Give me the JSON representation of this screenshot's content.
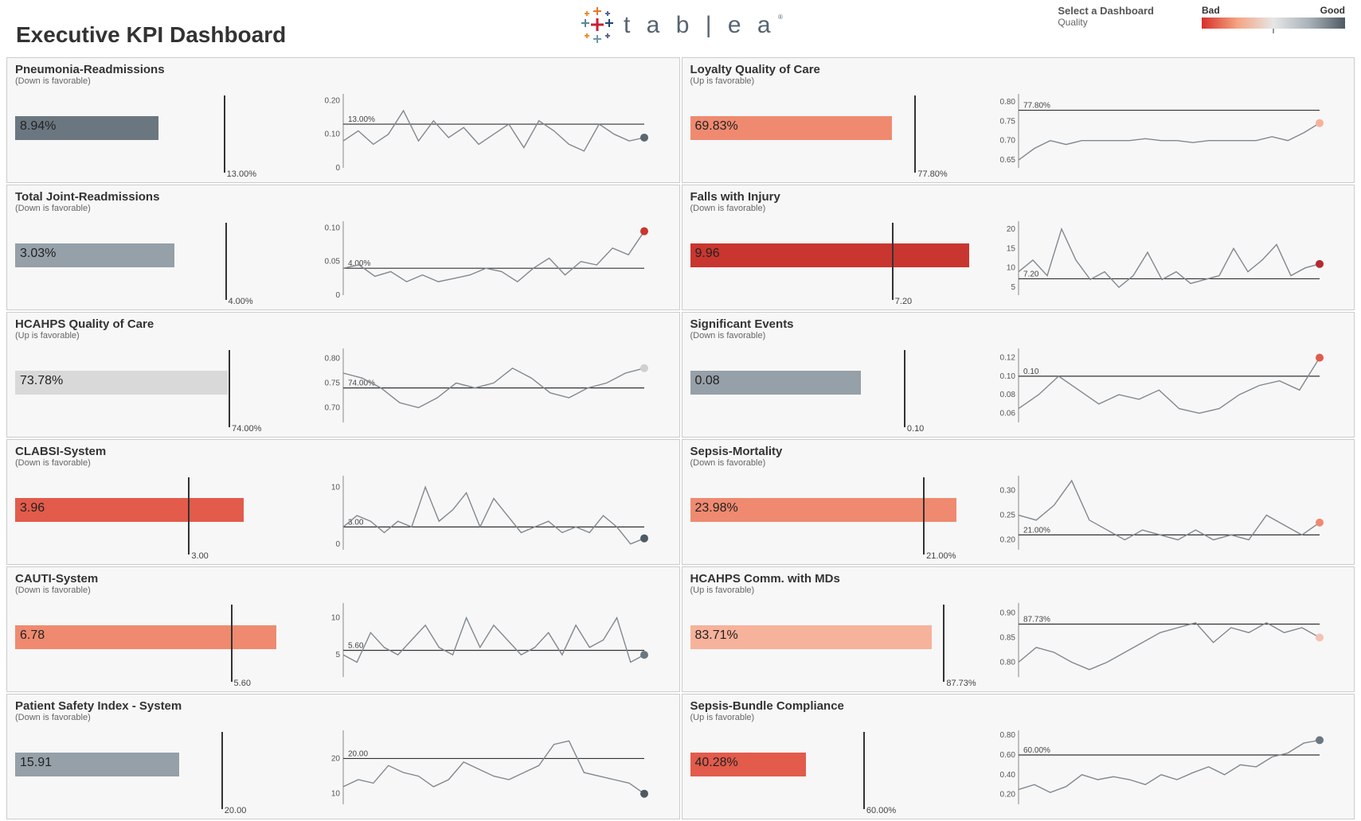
{
  "header": {
    "title": "Executive KPI Dashboard",
    "logo_text": "tableau",
    "selector_label": "Select a Dashboard",
    "selector_value": "Quality",
    "legend_bad": "Bad",
    "legend_good": "Good"
  },
  "colors": {
    "bad_deep": "#c8362f",
    "bad": "#e25b4b",
    "bad_light": "#ef8a70",
    "bad_pale": "#f7b29b",
    "neutral": "#d9d9d9",
    "good_light": "#95a0a8",
    "good": "#6b7780"
  },
  "chart_data": [
    {
      "id": "pneumonia",
      "title": "Pneumonia-Readmissions",
      "subtitle": "(Down is favorable)",
      "direction": "down",
      "value_display": "8.94%",
      "value": 8.94,
      "target": 13.0,
      "target_display": "13.00%",
      "bar_max": 18,
      "bar_color": "good",
      "spark": {
        "type": "line",
        "goal": 0.13,
        "goal_display": "13.00%",
        "ylim": [
          0.0,
          0.22
        ],
        "yticks": [
          0.0,
          0.1,
          0.2
        ],
        "values": [
          0.08,
          0.11,
          0.07,
          0.1,
          0.17,
          0.08,
          0.14,
          0.09,
          0.12,
          0.07,
          0.1,
          0.13,
          0.06,
          0.14,
          0.11,
          0.07,
          0.05,
          0.13,
          0.1,
          0.08,
          0.09
        ],
        "end_color": "#5b6770"
      }
    },
    {
      "id": "loyalty",
      "title": "Loyalty Quality of Care",
      "subtitle": "(Up is favorable)",
      "direction": "up",
      "value_display": "69.83%",
      "value": 69.83,
      "target": 77.8,
      "target_display": "77.80%",
      "bar_max": 100,
      "bar_color": "bad2",
      "spark": {
        "type": "line",
        "goal": 0.778,
        "goal_display": "77.80%",
        "ylim": [
          0.63,
          0.82
        ],
        "yticks": [
          0.65,
          0.7,
          0.75,
          0.8
        ],
        "values": [
          0.65,
          0.68,
          0.7,
          0.69,
          0.7,
          0.7,
          0.7,
          0.7,
          0.705,
          0.7,
          0.7,
          0.695,
          0.7,
          0.7,
          0.7,
          0.7,
          0.71,
          0.7,
          0.72,
          0.745
        ],
        "end_color": "#f7b29b"
      }
    },
    {
      "id": "joint",
      "title": "Total Joint-Readmissions",
      "subtitle": "(Down is favorable)",
      "direction": "down",
      "value_display": "3.03%",
      "value": 3.03,
      "target": 4.0,
      "target_display": "4.00%",
      "bar_max": 5.5,
      "bar_color": "good_light",
      "spark": {
        "type": "line",
        "goal": 0.04,
        "goal_display": "4.00%",
        "ylim": [
          0.0,
          0.11
        ],
        "yticks": [
          0.0,
          0.05,
          0.1
        ],
        "values": [
          0.04,
          0.045,
          0.028,
          0.035,
          0.02,
          0.03,
          0.02,
          0.025,
          0.03,
          0.04,
          0.035,
          0.02,
          0.04,
          0.055,
          0.03,
          0.05,
          0.045,
          0.07,
          0.06,
          0.095
        ],
        "end_color": "#c8362f"
      }
    },
    {
      "id": "falls",
      "title": "Falls with Injury",
      "subtitle": "(Down is favorable)",
      "direction": "down",
      "value_display": "9.96",
      "value": 9.96,
      "target": 7.2,
      "target_display": "7.20",
      "bar_max": 10.3,
      "bar_color": "bad4",
      "spark": {
        "type": "line",
        "goal": 7.2,
        "goal_display": "7.20",
        "ylim": [
          3,
          22
        ],
        "yticks": [
          5,
          10,
          15,
          20
        ],
        "values": [
          9,
          12,
          8,
          20,
          12,
          7,
          9,
          5,
          8,
          14,
          7,
          9,
          6,
          7,
          8,
          15,
          9,
          12,
          16,
          8,
          10,
          11
        ],
        "end_color": "#b42b2f"
      }
    },
    {
      "id": "hcahps_quality",
      "title": "HCAHPS Quality of Care",
      "subtitle": "(Up is favorable)",
      "direction": "up",
      "value_display": "73.78%",
      "value": 73.78,
      "target": 74.0,
      "target_display": "74.00%",
      "bar_max": 100,
      "bar_color": "neutral",
      "spark": {
        "type": "line",
        "goal": 0.74,
        "goal_display": "74.00%",
        "ylim": [
          0.67,
          0.82
        ],
        "yticks": [
          0.7,
          0.75,
          0.8
        ],
        "values": [
          0.77,
          0.76,
          0.74,
          0.71,
          0.7,
          0.72,
          0.75,
          0.74,
          0.75,
          0.78,
          0.76,
          0.73,
          0.72,
          0.74,
          0.75,
          0.77,
          0.78
        ],
        "end_color": "#d0d0d0"
      }
    },
    {
      "id": "sig_events",
      "title": "Significant Events",
      "subtitle": "(Down is favorable)",
      "direction": "down",
      "value_display": "0.08",
      "value": 0.08,
      "target": 0.1,
      "target_display": "0.10",
      "bar_max": 0.135,
      "bar_color": "good_light",
      "spark": {
        "type": "line",
        "goal": 0.1,
        "goal_display": "0.10",
        "ylim": [
          0.05,
          0.13
        ],
        "yticks": [
          0.06,
          0.08,
          0.1,
          0.12
        ],
        "values": [
          0.065,
          0.08,
          0.1,
          0.085,
          0.07,
          0.08,
          0.075,
          0.085,
          0.065,
          0.06,
          0.065,
          0.08,
          0.09,
          0.095,
          0.085,
          0.12
        ],
        "end_color": "#e25b4b"
      }
    },
    {
      "id": "clabsi",
      "title": "CLABSI-System",
      "subtitle": "(Down is favorable)",
      "direction": "down",
      "value_display": "3.96",
      "value": 3.96,
      "target": 3.0,
      "target_display": "3.00",
      "bar_max": 5.0,
      "bar_color": "bad3",
      "spark": {
        "type": "line",
        "goal": 3.0,
        "goal_display": "3.00",
        "ylim": [
          -1,
          12
        ],
        "yticks": [
          0,
          10
        ],
        "values": [
          3,
          5,
          4,
          2,
          4,
          3,
          10,
          4,
          6,
          9,
          3,
          8,
          5,
          2,
          3,
          4,
          2,
          3,
          2,
          5,
          3,
          0,
          1
        ],
        "end_color": "#4d5a63"
      }
    },
    {
      "id": "sepsis_mort",
      "title": "Sepsis-Mortality",
      "subtitle": "(Down is favorable)",
      "direction": "down",
      "value_display": "23.98%",
      "value": 23.98,
      "target": 21.0,
      "target_display": "21.00%",
      "bar_max": 26,
      "bar_color": "bad2",
      "spark": {
        "type": "line",
        "goal": 0.21,
        "goal_display": "21.00%",
        "ylim": [
          0.18,
          0.33
        ],
        "yticks": [
          0.2,
          0.25,
          0.3
        ],
        "values": [
          0.25,
          0.24,
          0.27,
          0.32,
          0.24,
          0.22,
          0.2,
          0.22,
          0.21,
          0.2,
          0.22,
          0.2,
          0.21,
          0.2,
          0.25,
          0.23,
          0.21,
          0.235
        ],
        "end_color": "#ef8a70"
      }
    },
    {
      "id": "cauti",
      "title": "CAUTI-System",
      "subtitle": "(Down is favorable)",
      "direction": "down",
      "value_display": "6.78",
      "value": 6.78,
      "target": 5.6,
      "target_display": "5.60",
      "bar_max": 7.5,
      "bar_color": "bad2",
      "spark": {
        "type": "line",
        "goal": 5.6,
        "goal_display": "5.60",
        "ylim": [
          2,
          12
        ],
        "yticks": [
          5,
          10
        ],
        "values": [
          5,
          4,
          8,
          6,
          5,
          7,
          9,
          6,
          5,
          10,
          6,
          9,
          7,
          5,
          6,
          8,
          5,
          9,
          6,
          7,
          10,
          4,
          5
        ],
        "end_color": "#6b7780"
      }
    },
    {
      "id": "hcahps_md",
      "title": "HCAHPS Comm. with MDs",
      "subtitle": "(Up is favorable)",
      "direction": "up",
      "value_display": "83.71%",
      "value": 83.71,
      "target": 87.73,
      "target_display": "87.73%",
      "bar_max": 100,
      "bar_color": "bad1",
      "spark": {
        "type": "line",
        "goal": 0.8773,
        "goal_display": "87.73%",
        "ylim": [
          0.77,
          0.92
        ],
        "yticks": [
          0.8,
          0.85,
          0.9
        ],
        "values": [
          0.8,
          0.83,
          0.82,
          0.8,
          0.785,
          0.8,
          0.82,
          0.84,
          0.86,
          0.87,
          0.88,
          0.84,
          0.87,
          0.86,
          0.88,
          0.86,
          0.87,
          0.85
        ],
        "end_color": "#f4c2b5"
      }
    },
    {
      "id": "psi",
      "title": "Patient Safety Index - System",
      "subtitle": "(Down is favorable)",
      "direction": "down",
      "value_display": "15.91",
      "value": 15.91,
      "target": 20.0,
      "target_display": "20.00",
      "bar_max": 28,
      "bar_color": "good_light",
      "spark": {
        "type": "line",
        "goal": 20.0,
        "goal_display": "20.00",
        "ylim": [
          7,
          28
        ],
        "yticks": [
          10,
          20
        ],
        "values": [
          12,
          14,
          13,
          18,
          16,
          15,
          12,
          14,
          19,
          17,
          15,
          14,
          16,
          18,
          24,
          25,
          16,
          15,
          14,
          13,
          10
        ],
        "end_color": "#4d5a63"
      }
    },
    {
      "id": "sepsis_bundle",
      "title": "Sepsis-Bundle Compliance",
      "subtitle": "(Up is favorable)",
      "direction": "up",
      "value_display": "40.28%",
      "value": 40.28,
      "target": 60.0,
      "target_display": "60.00%",
      "bar_max": 100,
      "bar_color": "bad3",
      "spark": {
        "type": "line",
        "goal": 0.6,
        "goal_display": "60.00%",
        "ylim": [
          0.1,
          0.85
        ],
        "yticks": [
          0.2,
          0.4,
          0.6,
          0.8
        ],
        "values": [
          0.25,
          0.3,
          0.22,
          0.28,
          0.4,
          0.35,
          0.38,
          0.35,
          0.3,
          0.4,
          0.35,
          0.42,
          0.48,
          0.4,
          0.5,
          0.48,
          0.58,
          0.62,
          0.72,
          0.75
        ],
        "end_color": "#6b7780"
      }
    }
  ]
}
